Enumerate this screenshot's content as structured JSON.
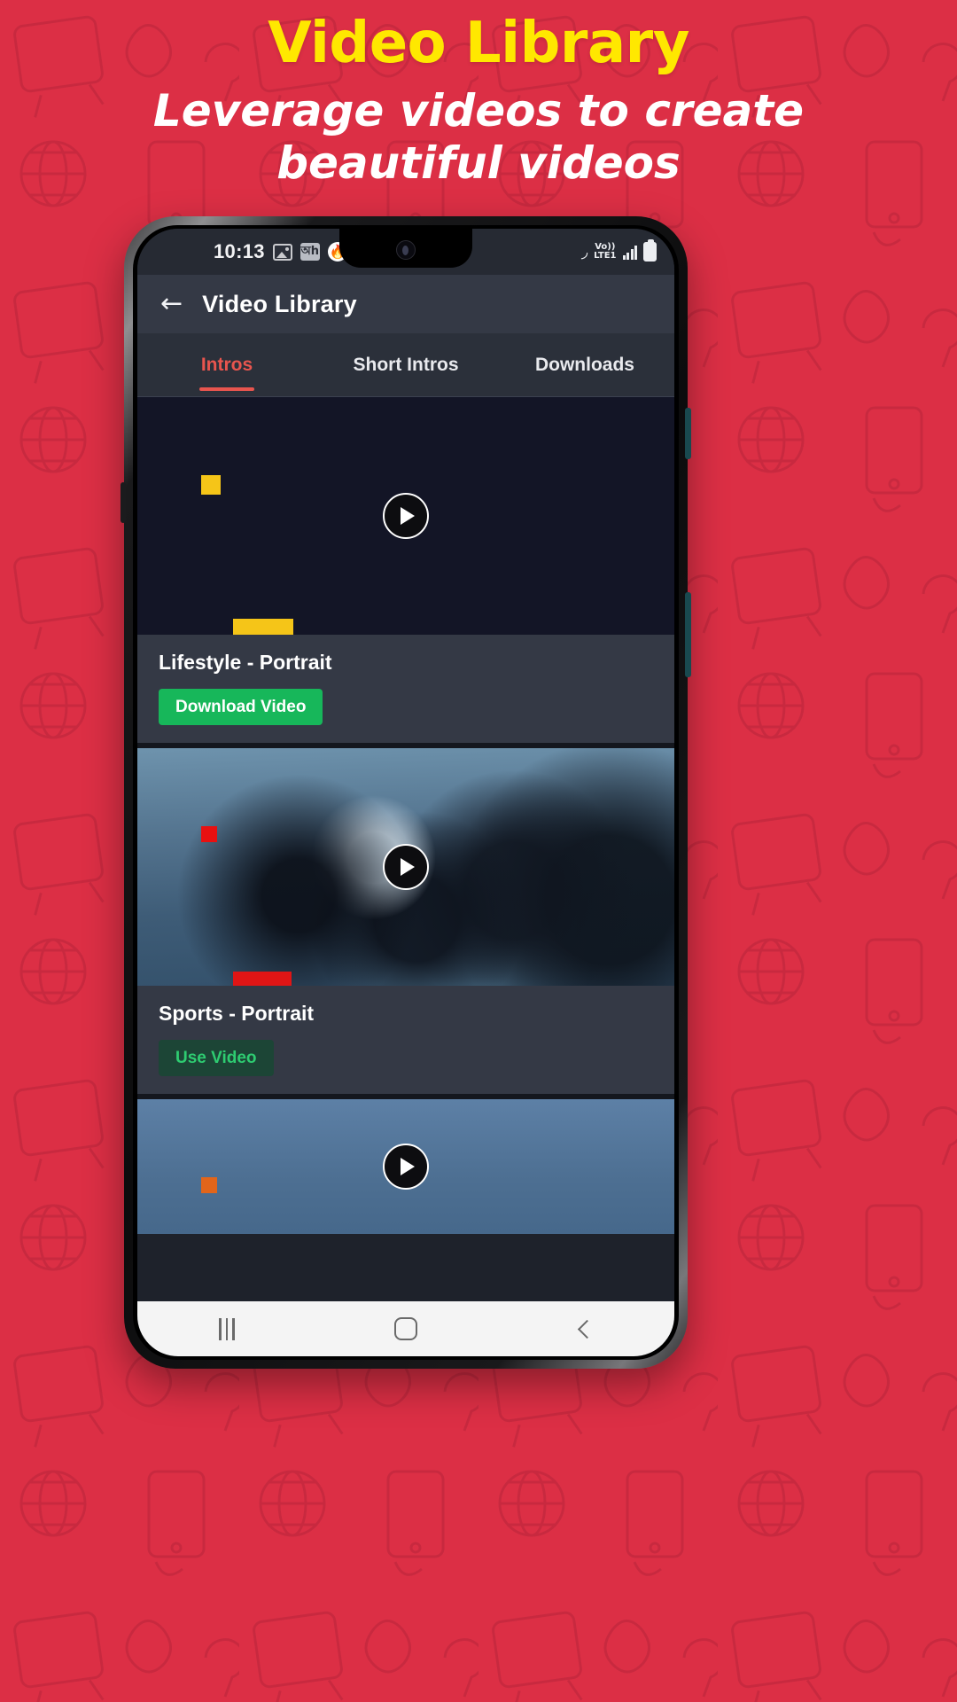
{
  "promo": {
    "title": "Video Library",
    "subtitle": "Leverage videos to create beautiful videos",
    "title_color": "#FFE800",
    "subtitle_color": "#FFFFFF",
    "background_color": "#DC2F45"
  },
  "status_bar": {
    "time": "10:13",
    "icons_left": [
      "gallery-icon",
      "app-icon",
      "flame-icon",
      "dot-icon"
    ],
    "app_icon_label": "অh",
    "flame_glyph": "🔥",
    "wifi_glyph": "◞",
    "volte_line1": "Vo))",
    "volte_line2": "LTE1",
    "icons_right": [
      "wifi-icon",
      "volte-icon",
      "signal-icon",
      "battery-icon"
    ]
  },
  "app_bar": {
    "back_glyph": "←",
    "title": "Video Library"
  },
  "tabs": [
    {
      "label": "Intros",
      "active": true
    },
    {
      "label": "Short Intros",
      "active": false
    },
    {
      "label": "Downloads",
      "active": false
    }
  ],
  "cards": [
    {
      "title": "Lifestyle - Portrait",
      "button_label": "Download Video",
      "button_style": "filled-green",
      "button_bg": "#17B75A",
      "button_fg": "#FFFFFF",
      "thumb_kind": "dark-navy"
    },
    {
      "title": "Sports - Portrait",
      "button_label": "Use Video",
      "button_style": "muted-green",
      "button_bg": "#1C4536",
      "button_fg": "#2ECC71",
      "thumb_kind": "sports-photo"
    },
    {
      "title": "",
      "button_label": "",
      "button_style": "",
      "thumb_kind": "blue-photo"
    }
  ],
  "nav_bar": {
    "recents_name": "recents-button",
    "home_name": "home-button",
    "back_name": "back-button"
  },
  "accent": {
    "tab_active": "#E8554E",
    "yellow_swatch": "#F5C518",
    "red_swatch": "#E01515",
    "orange_swatch": "#E2651A"
  }
}
